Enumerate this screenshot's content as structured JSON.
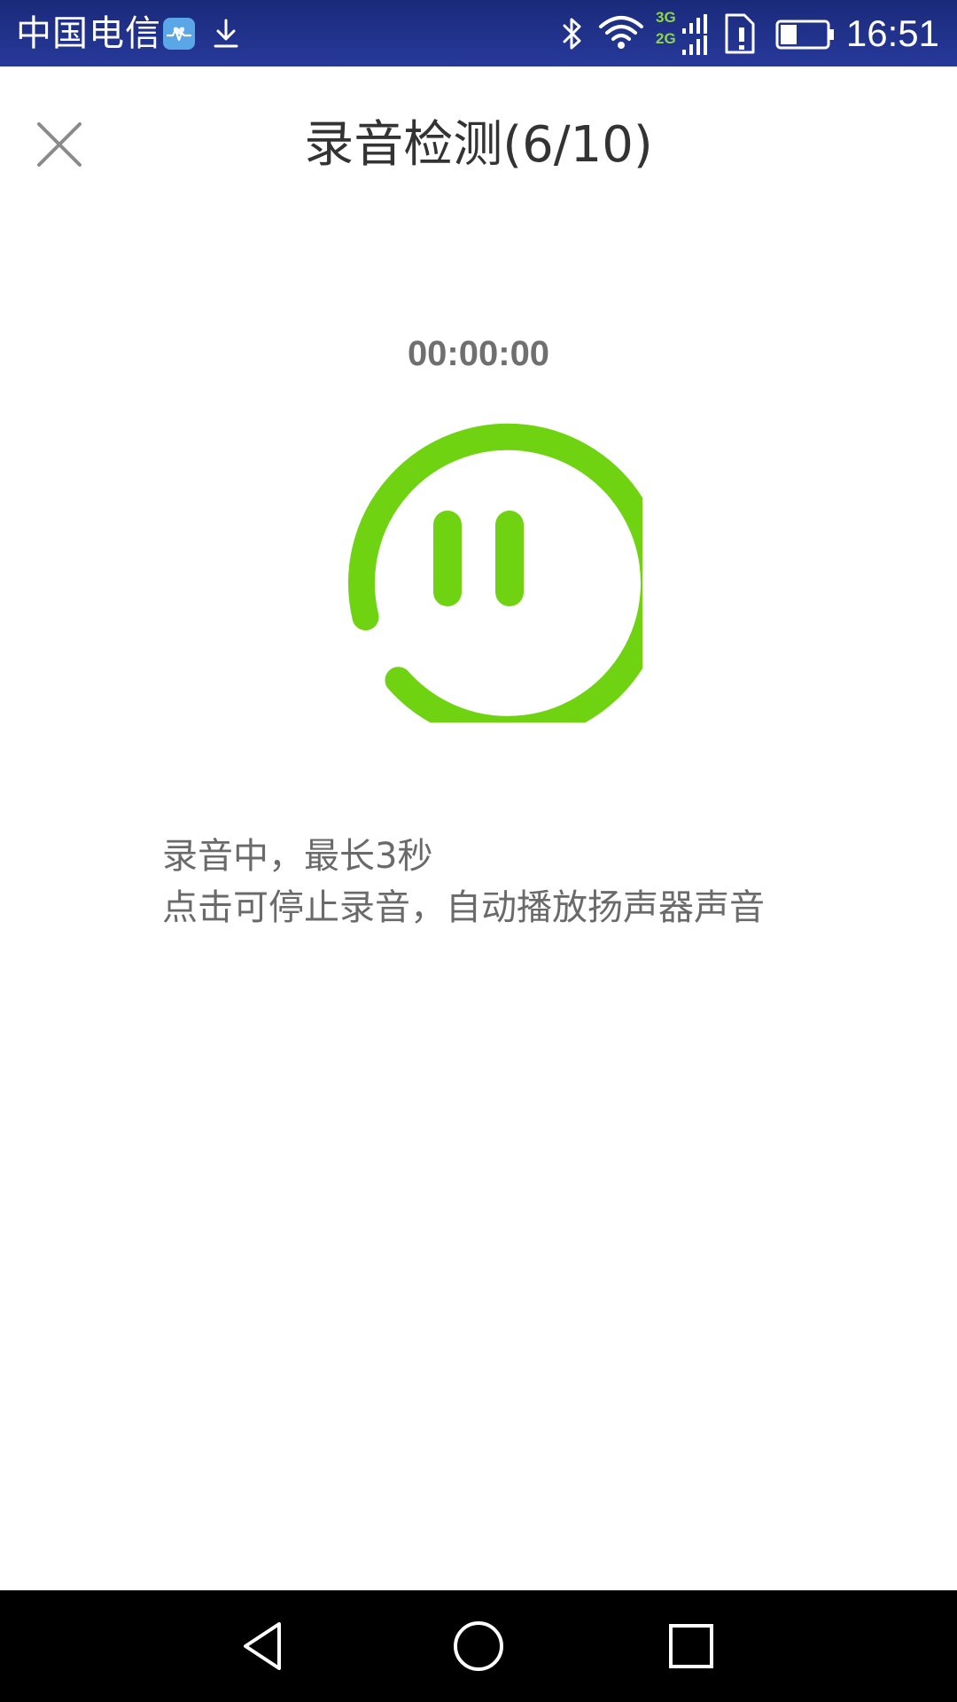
{
  "status_bar": {
    "carrier": "中国电信",
    "time": "16:51",
    "network_primary": "3G",
    "network_secondary": "2G",
    "battery_level": 0.35,
    "icons": [
      "health-icon",
      "download-icon",
      "bluetooth-icon",
      "wifi-icon",
      "cellular-signal-icon",
      "sim-alert-icon",
      "battery-icon"
    ]
  },
  "header": {
    "title": "录音检测(6/10)",
    "close_icon": "close-icon"
  },
  "recorder": {
    "timer": "00:00:00",
    "control_icon": "pause-icon",
    "ring_color": "#6fd312"
  },
  "instructions": {
    "line1": "录音中，最长3秒",
    "line2": "点击可停止录音，自动播放扬声器声音"
  },
  "nav_bar": {
    "back_icon": "back-icon",
    "home_icon": "home-icon",
    "recents_icon": "recents-icon"
  },
  "colors": {
    "status_bar": "#22338c",
    "accent_green": "#6fd312",
    "title_text": "#333333",
    "body_text": "#6a6a6a",
    "nav_bar": "#000000"
  }
}
